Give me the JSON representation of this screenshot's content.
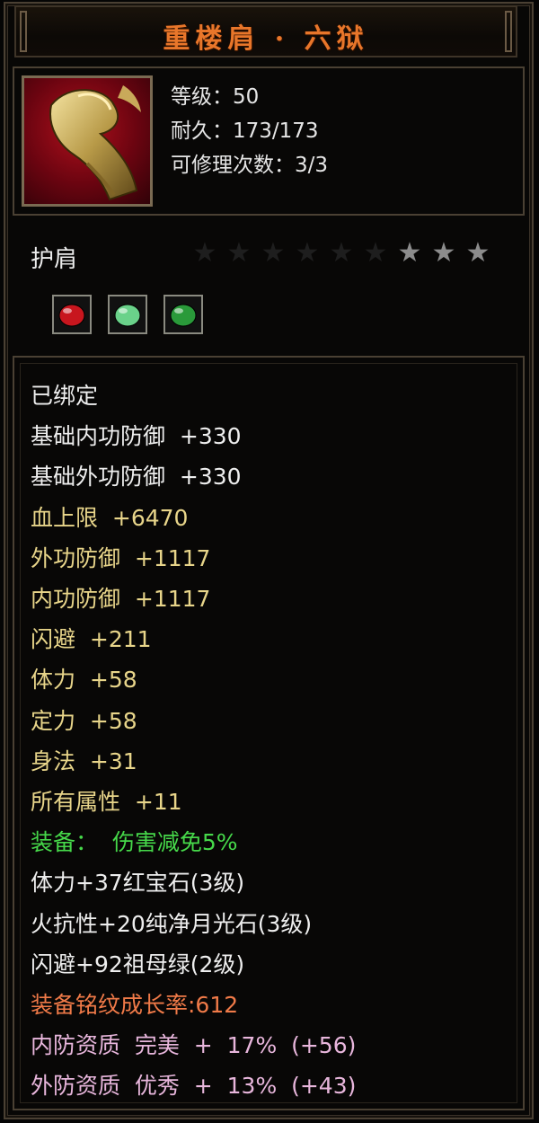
{
  "title": "重楼肩 · 六狱",
  "item": {
    "icon": "shoulder-armor-icon",
    "level": "等级：50",
    "durability": "耐久：173/173",
    "repairs": "可修理次数：3/3"
  },
  "type_label": "护肩",
  "stars": {
    "total": 9,
    "lit": 3
  },
  "gems": [
    {
      "icon": "red-ruby-gem-icon",
      "color": "#c8161e"
    },
    {
      "icon": "moonstone-gem-icon",
      "color": "#6ad28a"
    },
    {
      "icon": "emerald-gem-icon",
      "color": "#2a9a3a"
    }
  ],
  "attributes": [
    {
      "text": "已绑定",
      "style": "white"
    },
    {
      "text": "基础内功防御  +330",
      "style": "white"
    },
    {
      "text": "基础外功防御  +330",
      "style": "white"
    },
    {
      "text": "血上限  +6470",
      "style": "gold"
    },
    {
      "text": "外功防御  +1117",
      "style": "gold"
    },
    {
      "text": "内功防御  +1117",
      "style": "gold"
    },
    {
      "text": "闪避  +211",
      "style": "gold"
    },
    {
      "text": "体力  +58",
      "style": "gold"
    },
    {
      "text": "定力  +58",
      "style": "gold"
    },
    {
      "text": "身法  +31",
      "style": "gold"
    },
    {
      "text": "所有属性  +11",
      "style": "gold"
    },
    {
      "text": "装备：  伤害减免5%",
      "style": "green"
    },
    {
      "text": "体力+37红宝石(3级)",
      "style": "white"
    },
    {
      "text": "火抗性+20纯净月光石(3级)",
      "style": "white"
    },
    {
      "text": "闪避+92祖母绿(2级)",
      "style": "white"
    },
    {
      "text": "装备铭纹成长率:612",
      "style": "orange"
    },
    {
      "text": "内防资质  完美  +  17%  (+56)",
      "style": "pink"
    },
    {
      "text": "外防资质  优秀  +  13%  (+43)",
      "style": "pink"
    }
  ],
  "colors": {
    "title": "#e8762a",
    "white": "#eeeeee",
    "gold": "#e8d58a",
    "green": "#46d84a",
    "orange": "#f07a48",
    "pink": "#e8b6dc"
  }
}
